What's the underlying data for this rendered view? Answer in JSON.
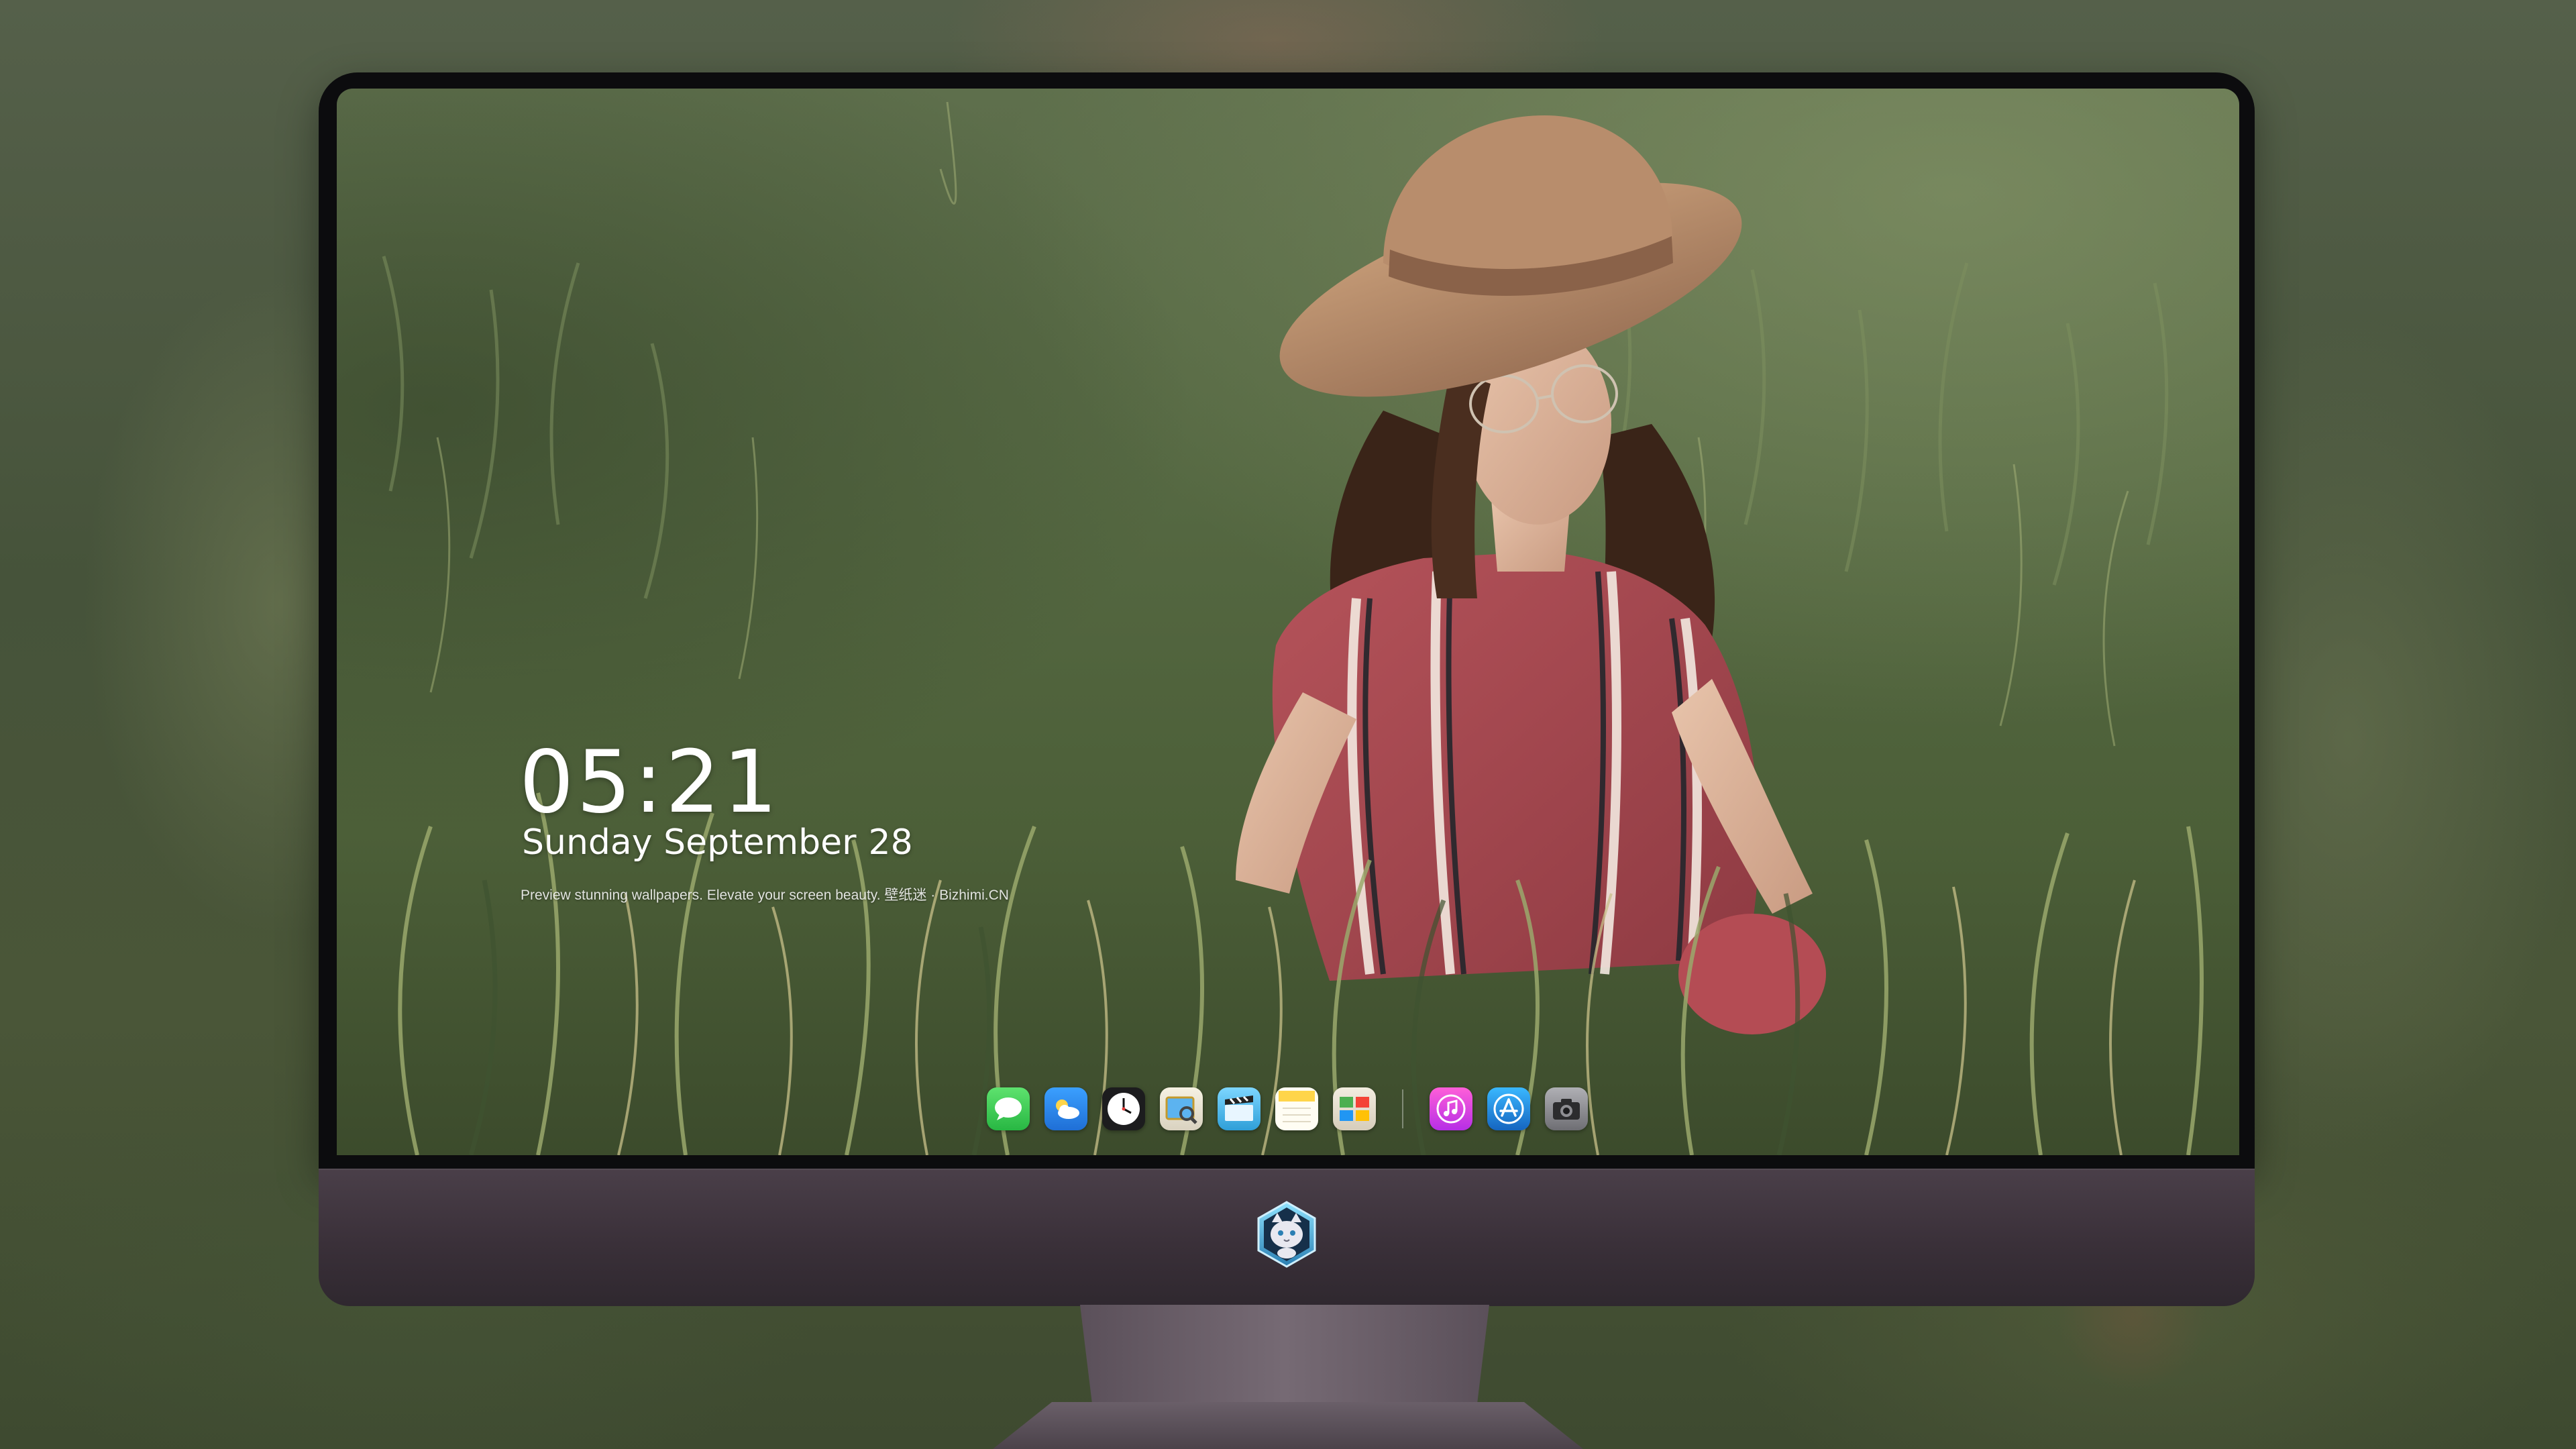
{
  "lock_screen": {
    "time": "05:21",
    "date_text": "Sunday September",
    "day": "28",
    "caption": "Preview stunning wallpapers. Elevate your screen beauty. 壁纸迷 · Bizhimi.CN"
  },
  "dock": {
    "apps": [
      {
        "name": "messages-icon",
        "color": "#34c759"
      },
      {
        "name": "weather-icon",
        "color": "#2f8cf0"
      },
      {
        "name": "clock-icon",
        "color": "#1c1c1e"
      },
      {
        "name": "preview-icon",
        "color": "#f2c94c"
      },
      {
        "name": "video-editor-icon",
        "color": "#5ac8fa"
      },
      {
        "name": "notes-icon",
        "color": "#ffd54a"
      },
      {
        "name": "photo-booth-icon",
        "color": "#e8e0d0"
      },
      {
        "name": "music-icon",
        "color": "#e040fb"
      },
      {
        "name": "app-store-icon",
        "color": "#1e88e5"
      },
      {
        "name": "camera-icon",
        "color": "#8e8e93"
      }
    ]
  },
  "monitor": {
    "chin_color": "#3a3039",
    "logo": "cat-mascot-logo"
  }
}
